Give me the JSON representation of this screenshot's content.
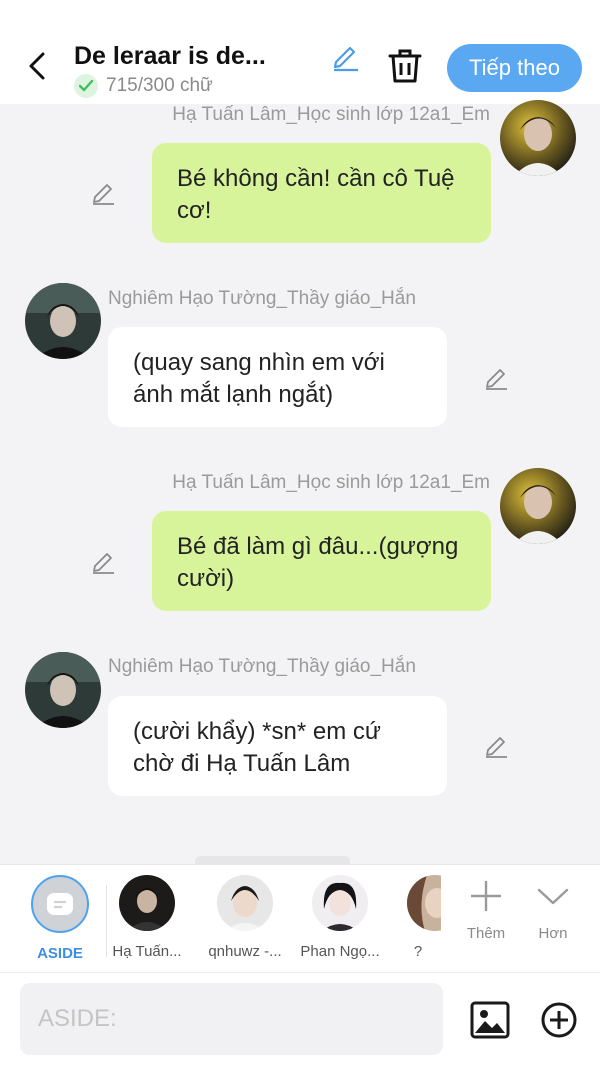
{
  "header": {
    "title": "De leraar is de...",
    "char_count": "715/300 chữ",
    "next_label": "Tiếp theo",
    "accent_color": "#5aa8f2"
  },
  "messages": [
    {
      "sender": "Hạ Tuấn Lâm_Học sinh lớp 12a1_Em",
      "side": "right",
      "text": "Bé không cần! cần cô Tuệ cơ!"
    },
    {
      "sender": "Nghiêm Hạo Tường_Thầy giáo_Hắn",
      "side": "left",
      "text": "(quay sang nhìn em với ánh mắt lạnh ngắt)"
    },
    {
      "sender": "Hạ Tuấn Lâm_Học sinh lớp 12a1_Em",
      "side": "right",
      "text": "Bé đã làm gì đâu...(gượng cười)"
    },
    {
      "sender": "Nghiêm Hạo Tường_Thầy giáo_Hắn",
      "side": "left",
      "text": "(cười khẩy) *sn* em cứ chờ đi Hạ Tuấn Lâm"
    }
  ],
  "characters": {
    "aside_label": "ASIDE",
    "items": [
      {
        "label": "Hạ Tuấn..."
      },
      {
        "label": "qnhuwz -..."
      },
      {
        "label": "Phan Ngọ..."
      },
      {
        "label": "?"
      }
    ],
    "more_label": "Thêm",
    "less_label": "Hơn"
  },
  "composer": {
    "placeholder": "ASIDE:"
  },
  "colors": {
    "my_bubble": "#d8f49a",
    "their_bubble": "#ffffff",
    "background": "#f3f3f5"
  }
}
